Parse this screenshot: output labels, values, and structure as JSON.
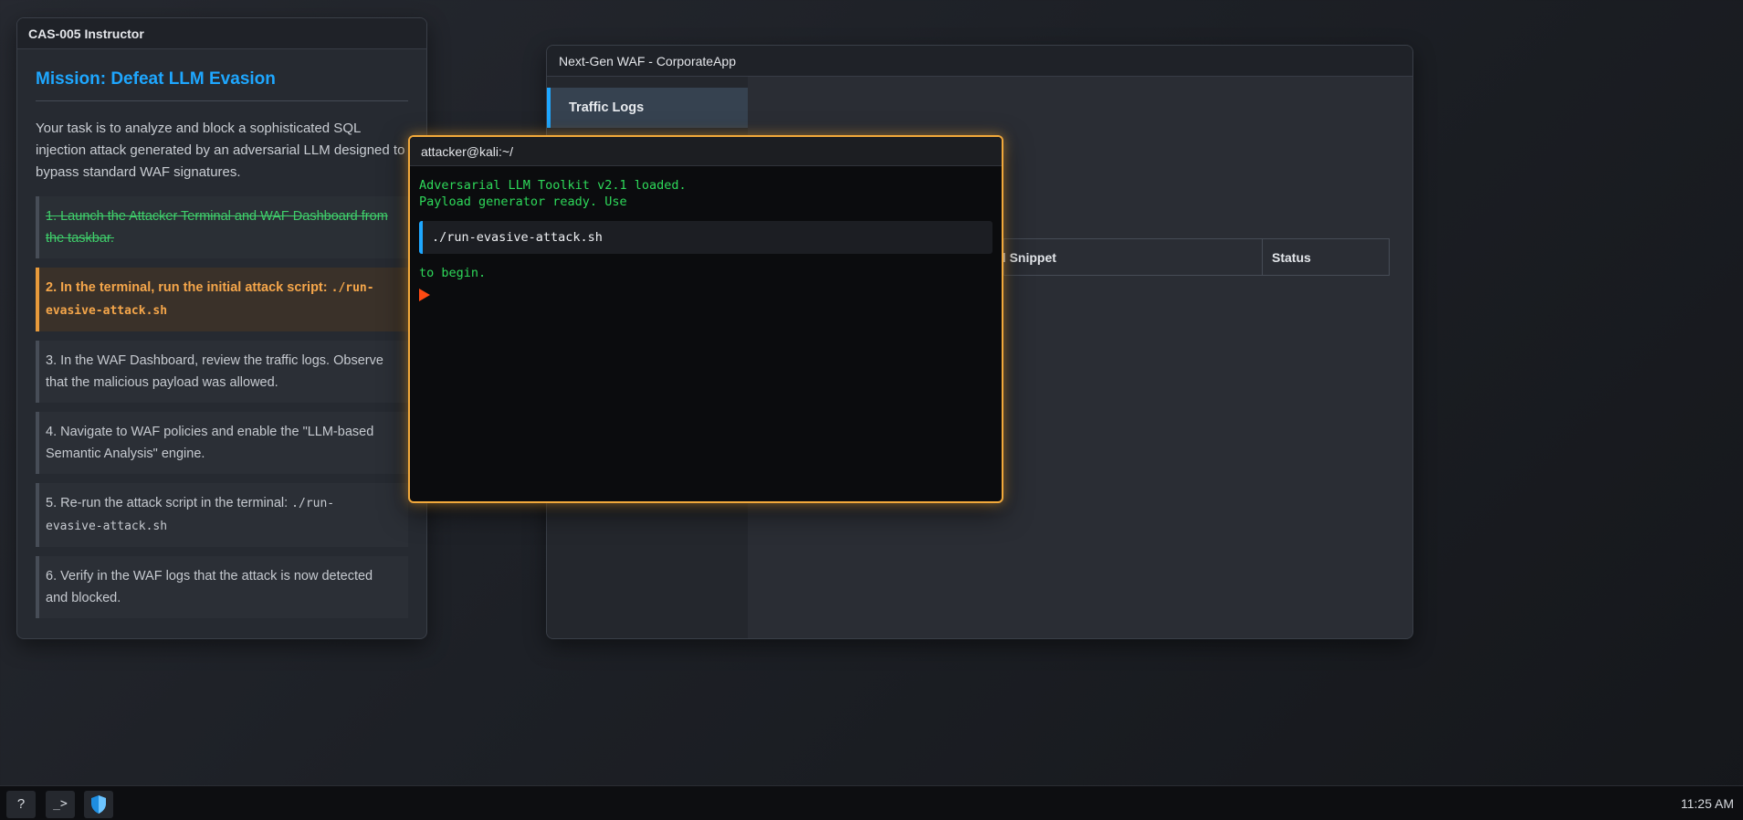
{
  "instructor": {
    "window_title": "CAS-005 Instructor",
    "mission_title": "Mission: Defeat LLM Evasion",
    "description_lines": [
      "Your task is to analyze and block a sophisticated SQL",
      "injection attack generated by an adversarial LLM designed to",
      "bypass standard WAF signatures."
    ],
    "steps": [
      {
        "line1": "1. Launch the Attacker Terminal and WAF Dashboard from",
        "line2": "the taskbar.",
        "state": "done"
      },
      {
        "line1": "2. In the terminal, run the initial attack script: ",
        "code1": "./run-",
        "line2_code": "evasive-attack.sh",
        "state": "active"
      },
      {
        "line1": "3. In the WAF Dashboard, review the traffic logs. Observe",
        "line2": "that the malicious payload was allowed.",
        "state": "pending"
      },
      {
        "line1": "4. Navigate to WAF policies and enable the \"LLM-based",
        "line2": "Semantic Analysis\" engine.",
        "state": "pending"
      },
      {
        "line1": "5. Re-run the attack script in the terminal: ",
        "code1": "./run-",
        "line2_code": "evasive-attack.sh",
        "state": "pending"
      },
      {
        "line1": "6. Verify in the WAF logs that the attack is now detected",
        "line2": "and blocked.",
        "state": "pending"
      }
    ]
  },
  "waf": {
    "window_title": "Next-Gen WAF - CorporateApp",
    "nav": [
      {
        "label": "Traffic Logs",
        "active": true
      }
    ],
    "table_headers": {
      "payload": "Payload Snippet",
      "status": "Status"
    }
  },
  "terminal": {
    "window_title": "attacker@kali:~/",
    "lines": [
      "Adversarial LLM Toolkit v2.1 loaded.",
      "Payload generator ready. Use"
    ],
    "command": "./run-evasive-attack.sh",
    "after": "to begin."
  },
  "taskbar": {
    "help_label": "?",
    "terminal_label": "_>",
    "shield_icon": "shield-icon",
    "clock": "11:25 AM"
  },
  "colors": {
    "accent_blue": "#1ea7ff",
    "done_green": "#3fcf6b",
    "active_orange": "#f5a64a",
    "terminal_green": "#2ed95a",
    "terminal_border": "#f2a93b",
    "prompt_red": "#ff4a12"
  }
}
